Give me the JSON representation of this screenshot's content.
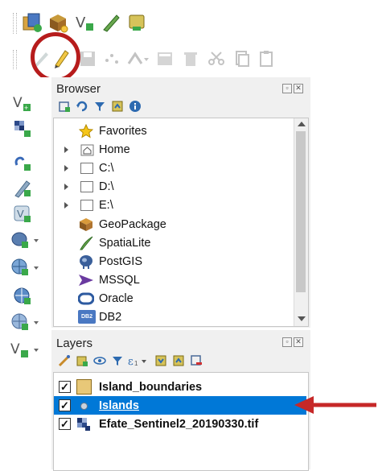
{
  "browser": {
    "title": "Browser",
    "items": [
      {
        "label": "Favorites",
        "icon": "star-icon"
      },
      {
        "label": "Home",
        "icon": "home-folder-icon"
      },
      {
        "label": "C:\\",
        "icon": "folder-icon"
      },
      {
        "label": "D:\\",
        "icon": "folder-icon"
      },
      {
        "label": "E:\\",
        "icon": "folder-icon"
      },
      {
        "label": "GeoPackage",
        "icon": "geopackage-icon"
      },
      {
        "label": "SpatiaLite",
        "icon": "spatialite-icon"
      },
      {
        "label": "PostGIS",
        "icon": "postgis-icon"
      },
      {
        "label": "MSSQL",
        "icon": "mssql-icon"
      },
      {
        "label": "Oracle",
        "icon": "oracle-icon"
      },
      {
        "label": "DB2",
        "icon": "db2-icon",
        "badge": "DB2"
      }
    ]
  },
  "layers": {
    "title": "Layers",
    "items": [
      {
        "label": "Island_boundaries",
        "checked": "✓",
        "selected": false
      },
      {
        "label": "Islands",
        "checked": "✓",
        "selected": true
      },
      {
        "label": "Efate_Sentinel2_20190330.tif",
        "checked": "✓",
        "selected": false
      }
    ]
  },
  "colors": {
    "highlight_circle": "#b71c1c",
    "annotation_arrow": "#c62828",
    "selection": "#0078d7",
    "polygon_fill": "#e8c878"
  }
}
